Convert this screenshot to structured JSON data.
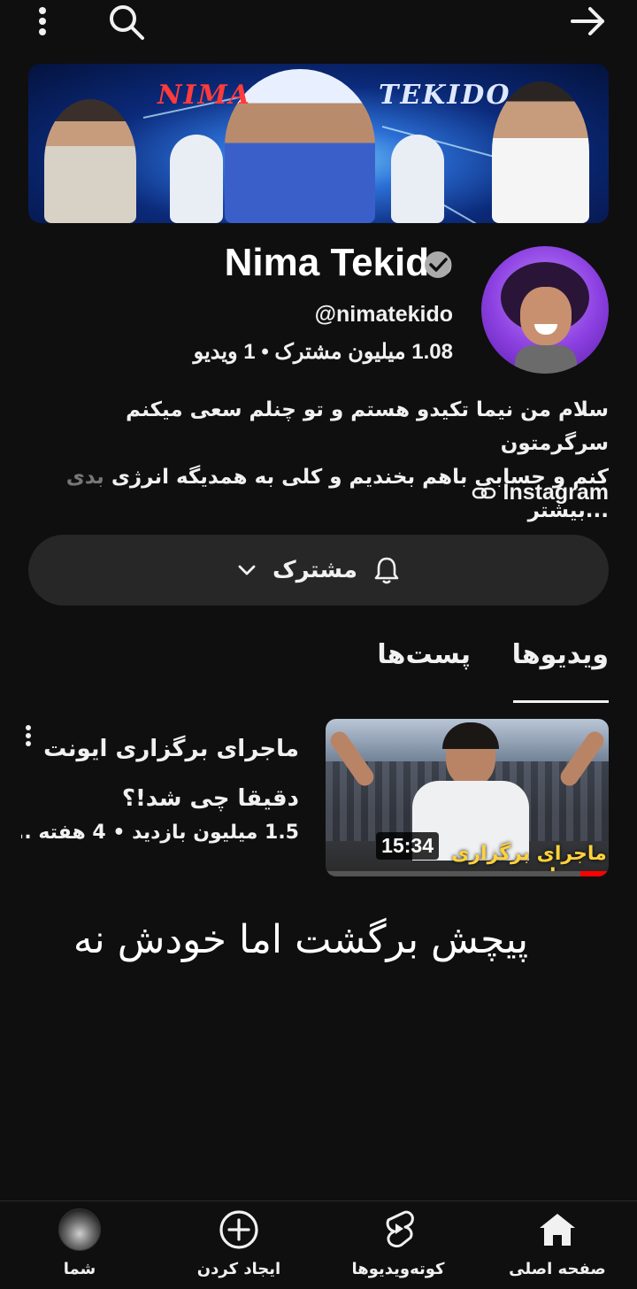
{
  "icons": {
    "more": "more-vert-icon",
    "search": "search-icon",
    "back": "arrow-forward-icon",
    "verified": "verified-icon",
    "link": "link-icon",
    "bell": "bell-icon",
    "chevron": "chevron-down-icon"
  },
  "banner": {
    "word_left": "NIMA",
    "word_right": "TEKIDO"
  },
  "channel": {
    "name": "Nima Tekido",
    "handle": "@nimatekido",
    "stats": "1.08 میلیون مشترک • 1 ویدیو",
    "description_line1": "سلام من نیما تکیدو هستم و تو چنلم سعی میکنم سرگرمتون",
    "description_line2_a": "کنم و حسابی باهم بخندیم و کلی به همدیگه انرژی ",
    "description_line2_fade": "بدی",
    "description_more": "...بیشتر",
    "link_label": "Instagram",
    "subscribe_label": "مشترک"
  },
  "tabs": {
    "videos": "ویدیوها",
    "posts": "پست‌ها"
  },
  "video": {
    "title_line1": "ماجرای برگزاری ایونت",
    "title_line2": "دقیقا چی شد!؟",
    "meta": "1.5 میلیون بازدید • 4 هفته ...",
    "duration": "15:34",
    "thumb_caption": "ماجرای برگزاری ایونت"
  },
  "overlay_text": "پیچش برگشت اما خودش نه",
  "bottom_nav": {
    "home": "صفحه اصلی",
    "shorts": "کوته‌ویدیوها",
    "create": "ایجاد کردن",
    "you": "شما"
  },
  "colors": {
    "background": "#0f0f0f",
    "surface": "#272727",
    "accent_red": "#ff0000",
    "banner_left_word": "#ff3b3b",
    "banner_right_word": "#dfe9ff"
  }
}
